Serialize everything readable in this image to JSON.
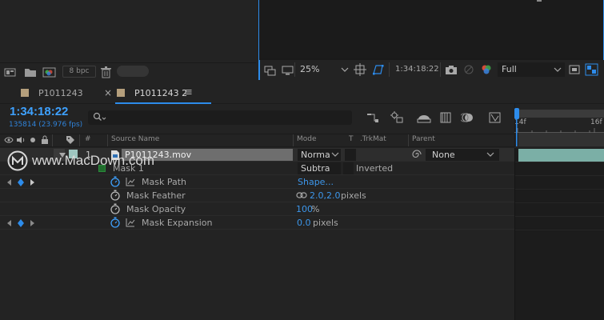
{
  "project_panel": {
    "bpc_label": "8 bpc"
  },
  "viewer": {
    "zoom": "25%",
    "timecode": "1:34:18:22",
    "resolution": "Full"
  },
  "tabs": [
    {
      "label": "P1011243",
      "close": "×"
    },
    {
      "label": "P1011243 2",
      "menu": "≡"
    }
  ],
  "timeline": {
    "timecode": "1:34:18:22",
    "frames_fps": "135814 (23.976 fps)",
    "search_placeholder": "",
    "ruler_labels": [
      "14f",
      "16f"
    ]
  },
  "columns": {
    "hash": "#",
    "source_name": "Source Name",
    "mode": "Mode",
    "t": "T",
    "trkmat": ".TrkMat",
    "parent": "Parent"
  },
  "layer": {
    "number": "1",
    "name": "P1011243.mov",
    "mode": "Norma",
    "parent": "None"
  },
  "mask": {
    "name": "Mask 1",
    "mode": "Subtra",
    "inverted_label": "Inverted",
    "properties": [
      {
        "label": "Mask Path",
        "value": "Shape...",
        "unit": ""
      },
      {
        "label": "Mask Feather",
        "value": "2.0,2.0",
        "unit": "pixels"
      },
      {
        "label": "Mask Opacity",
        "value": "100",
        "unit": "%"
      },
      {
        "label": "Mask Expansion",
        "value": "0.0",
        "unit": "pixels"
      }
    ]
  },
  "watermark": {
    "text": "www.MacDown.com"
  },
  "colors": {
    "accent_blue": "#2d8ceb",
    "timecode_blue": "#3ea1ff",
    "layer_bar": "#7bafa6",
    "label_swatch": "#b59f7c"
  }
}
